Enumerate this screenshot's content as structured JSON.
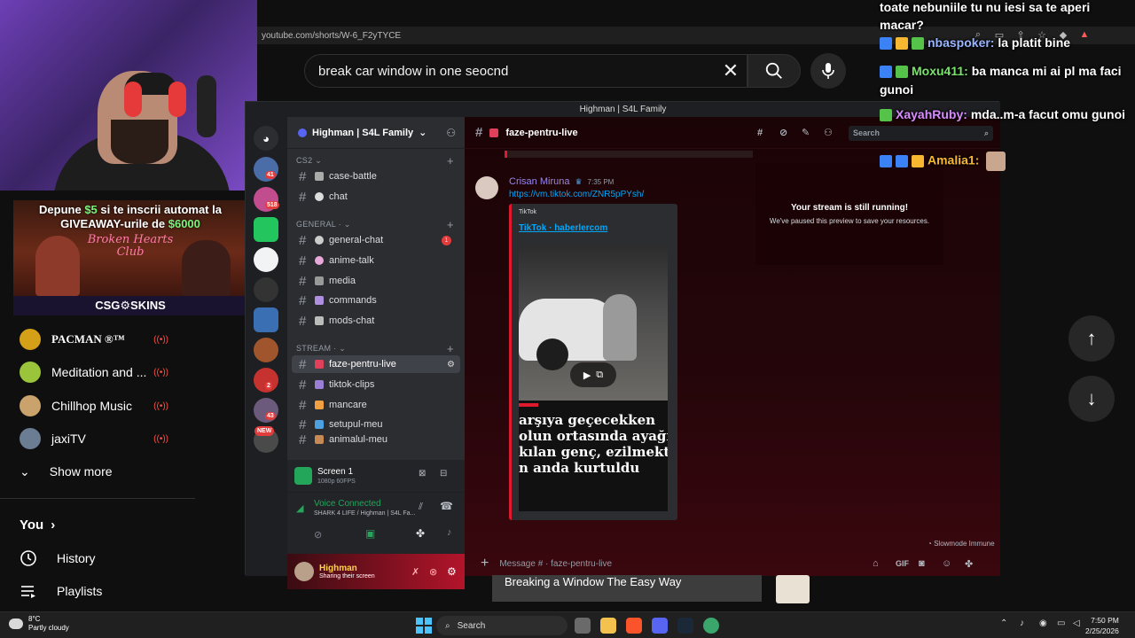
{
  "browser": {
    "url": "youtube.com/shorts/W-6_F2yTYCE"
  },
  "youtube": {
    "search_value": "break car window in one seocnd",
    "subscriptions": [
      {
        "name": "PACMAN ®™",
        "color": "#d4a017"
      },
      {
        "name": "Meditation and ...",
        "color": "#9ac43a"
      },
      {
        "name": "Chillhop Music",
        "color": "#c9a36b"
      },
      {
        "name": "jaxiTV",
        "color": "#6b7d92"
      }
    ],
    "show_more": "Show more",
    "you_label": "You",
    "history": "History",
    "playlists": "Playlists",
    "video_title": "Breaking a Window The Easy Way"
  },
  "stream_overlay": {
    "giveaway_line1_prefix": "Depune ",
    "giveaway_line1_money": "$5",
    "giveaway_line1_suffix": " si te inscrii automat la",
    "giveaway_line2_prefix": "GIVEAWAY-urile de ",
    "giveaway_line2_money": "$6000",
    "club_text": "Broken Hearts Club",
    "brand": "CSG⚙SKINS"
  },
  "chat_overlay": [
    {
      "user": "",
      "text": "toate nebuniile tu nu iesi sa te aperi macar?",
      "color": "#ffffff"
    },
    {
      "user": "nbaspoker:",
      "text": "la platit bine",
      "color": "#9ab5ff"
    },
    {
      "user": "Moxu411:",
      "text": "ba manca mi ai pl ma faci gunoi",
      "color": "#79e36b"
    },
    {
      "user": "XayahRuby:",
      "text": "mda..m-a facut omu gunoi",
      "color": "#d98cff"
    },
    {
      "user": "Amalia1:",
      "text": "",
      "color": "#f7b731"
    }
  ],
  "discord": {
    "window_title": "Highman | S4L Family",
    "guild_name": "Highman | S4L Family",
    "server_badges": [
      "41",
      "518",
      "2",
      "43"
    ],
    "new_badge": "NEW",
    "categories": {
      "cs2": "CS2",
      "general": "GENERAL ·",
      "stream": "STREAM ·"
    },
    "channels": {
      "case_battle": "case-battle",
      "chat": "chat",
      "general_chat": "general-chat",
      "anime_talk": "anime-talk",
      "media": "media",
      "commands": "commands",
      "mods_chat": "mods-chat",
      "faze_pentru_live": "faze-pentru-live",
      "tiktok_clips": "tiktok-clips",
      "mancare": "mancare",
      "setupul_meu": "setupul-meu",
      "animalul_meu": "animalul-meu"
    },
    "general_chat_unread": "1",
    "current_channel": "faze-pentru-live",
    "search_placeholder": "Search",
    "stream": {
      "title": "Screen 1",
      "quality": "1080p 60FPS",
      "voice_status": "Voice Connected",
      "voice_channel": "SHARK 4 LIFE / Highman | S4L Fa..."
    },
    "user": {
      "name": "Highman",
      "status": "Sharing their screen"
    },
    "message": {
      "author": "Crisan Miruna",
      "time": "7:35 PM",
      "link": "https://vm.tiktok.com/ZNR5pPYsh/",
      "embed_provider": "TikTok",
      "embed_title": "TikTok · haberlercom",
      "headline": "arşıya geçecekken\nolun ortasında ayağı\nkılan genç, ezilmekt\nn anda kurtuldu"
    },
    "notice_title": "Your stream is still running!",
    "notice_body": "We've paused this preview to save your resources.",
    "slowmode": "Slowmode Immune",
    "composer_placeholder": "Message # · faze-pentru-live"
  },
  "taskbar": {
    "temperature": "8°C",
    "weather": "Partly cloudy",
    "search": "Search",
    "time": "7:50 PM",
    "date": "2/25/2026"
  },
  "colors": {
    "discord_accent": "#e01a2e",
    "link": "#00a8fc",
    "live_red": "#ff4e45"
  }
}
